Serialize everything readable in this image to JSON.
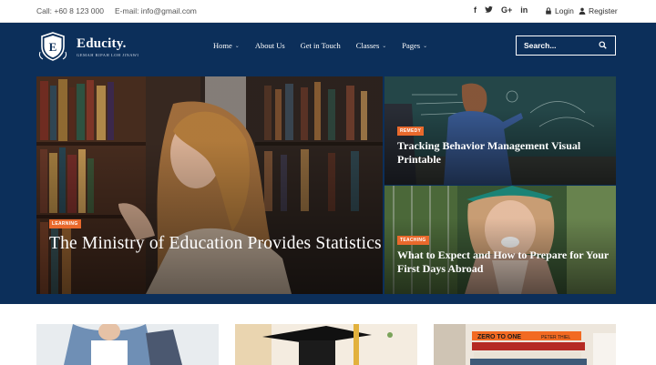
{
  "topbar": {
    "call": "Call: +60 8 123 000",
    "email": "E-mail: info@gmail.com",
    "social": [
      "f",
      "✓",
      "G+",
      "in"
    ],
    "social_icons": [
      "facebook-icon",
      "twitter-icon",
      "google-plus-icon",
      "linkedin-icon"
    ],
    "login": "Login",
    "register": "Register"
  },
  "header": {
    "logo_letter": "E",
    "brand": "Educity.",
    "tagline": "GEMAH RIPAH LOH JINAWI",
    "nav": [
      {
        "label": "Home",
        "has_dropdown": true
      },
      {
        "label": "About Us",
        "has_dropdown": false
      },
      {
        "label": "Get in Touch",
        "has_dropdown": false
      },
      {
        "label": "Classes",
        "has_dropdown": true
      },
      {
        "label": "Pages",
        "has_dropdown": true
      }
    ],
    "search_placeholder": "Search..."
  },
  "hero": {
    "main": {
      "badge": "LEARNING",
      "title": "The Ministry of Education Provides Statistics"
    },
    "side1": {
      "badge": "REMEDY",
      "title": "Tracking Behavior Management Visual Printable"
    },
    "side2": {
      "badge": "TEACHING",
      "title": "What to Expect and How to Prepare for Your First Days Abroad"
    }
  },
  "cards": {
    "book_labels": [
      "ZERO TO ONE",
      "PETER THIEL"
    ]
  },
  "colors": {
    "navy": "#0c2f5a",
    "badge_orange": "#e9692c"
  }
}
